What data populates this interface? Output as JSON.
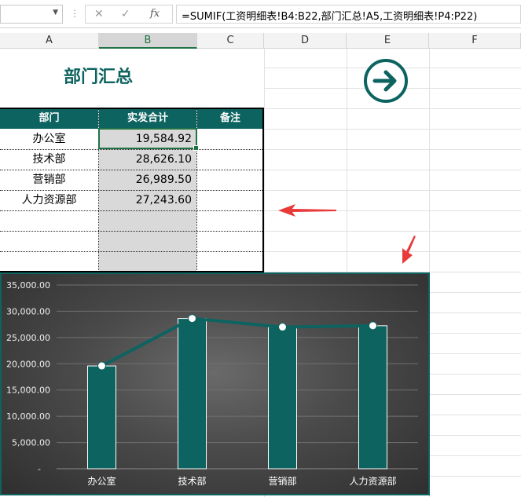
{
  "formula_bar": {
    "formula": "=SUMIF(工资明细表!B4:B22,部门汇总!A5,工资明细表!P4:P22)",
    "cancel_glyph": "✕",
    "enter_glyph": "✓",
    "fx_glyph": "fx"
  },
  "columns": [
    "A",
    "B",
    "C",
    "D",
    "E",
    "F"
  ],
  "sheet": {
    "title": "部门汇总",
    "headers": [
      "部门",
      "实发合计",
      "备注"
    ],
    "rows": [
      {
        "dept": "办公室",
        "total": "19,584.92",
        "note": ""
      },
      {
        "dept": "技术部",
        "total": "28,626.10",
        "note": ""
      },
      {
        "dept": "营销部",
        "total": "26,989.50",
        "note": ""
      },
      {
        "dept": "人力资源部",
        "total": "27,243.60",
        "note": ""
      }
    ]
  },
  "icons": {
    "navigate": "arrow-right-circle-icon",
    "annotation_left": "red-arrow-left-icon",
    "annotation_down": "red-arrow-down-icon"
  },
  "colors": {
    "accent": "#0d6360",
    "selection": "#217346",
    "annotation": "#e83a3a"
  },
  "chart_data": {
    "type": "bar",
    "categories": [
      "办公室",
      "技术部",
      "营销部",
      "人力资源部"
    ],
    "series": [
      {
        "type": "bar",
        "values": [
          19584.92,
          28626.1,
          26989.5,
          27243.6
        ]
      },
      {
        "type": "line",
        "values": [
          19584.92,
          28626.1,
          26989.5,
          27243.6
        ]
      }
    ],
    "ylim": [
      0,
      35000
    ],
    "yticks": [
      "-",
      "5,000.00",
      "10,000.00",
      "15,000.00",
      "20,000.00",
      "25,000.00",
      "30,000.00",
      "35,000.00"
    ],
    "grid": true
  }
}
